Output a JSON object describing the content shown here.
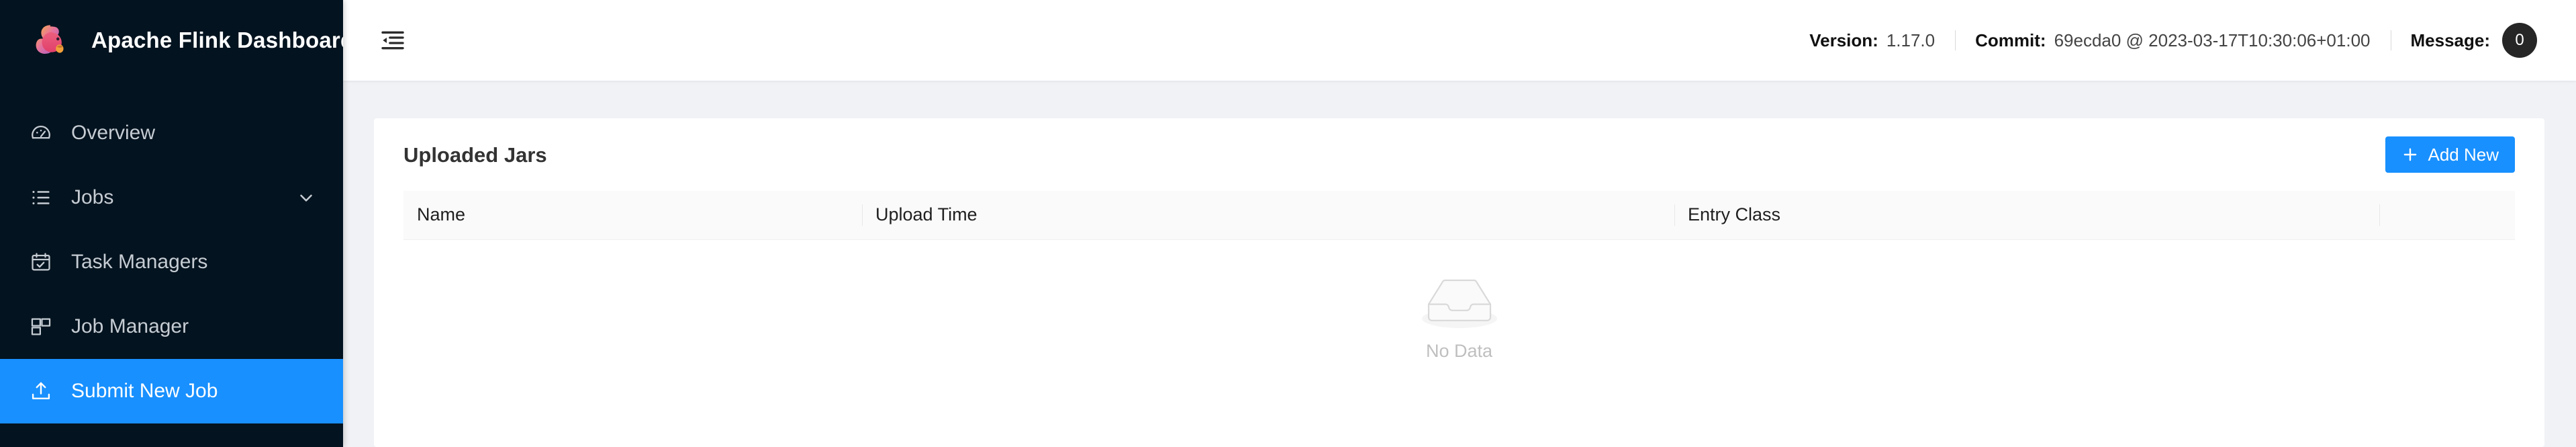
{
  "brand": {
    "title": "Apache Flink Dashboard",
    "logo_icon": "flink-squirrel-logo"
  },
  "sidebar": {
    "items": [
      {
        "label": "Overview",
        "icon": "dashboard-gauge-icon",
        "active": false,
        "expandable": false
      },
      {
        "label": "Jobs",
        "icon": "unordered-list-icon",
        "active": false,
        "expandable": true
      },
      {
        "label": "Task Managers",
        "icon": "calendar-check-icon",
        "active": false,
        "expandable": false
      },
      {
        "label": "Job Manager",
        "icon": "layout-blocks-icon",
        "active": false,
        "expandable": false
      },
      {
        "label": "Submit New Job",
        "icon": "upload-icon",
        "active": true,
        "expandable": false
      }
    ]
  },
  "topbar": {
    "fold_icon": "menu-fold-icon",
    "version_label": "Version:",
    "version_value": "1.17.0",
    "commit_label": "Commit:",
    "commit_value": "69ecda0 @ 2023-03-17T10:30:06+01:00",
    "message_label": "Message:",
    "message_count": "0"
  },
  "card": {
    "title": "Uploaded Jars",
    "add_button": "Add New",
    "add_icon": "plus-icon"
  },
  "table": {
    "columns": [
      "Name",
      "Upload Time",
      "Entry Class",
      ""
    ],
    "rows": [],
    "empty_text": "No Data",
    "empty_icon": "empty-inbox-icon"
  },
  "colors": {
    "sidebar_bg": "#03131f",
    "accent": "#1890ff",
    "page_bg": "#f0f2f5",
    "card_bg": "#ffffff",
    "table_head_bg": "#fafafa",
    "empty_text": "#bfbfbf"
  }
}
